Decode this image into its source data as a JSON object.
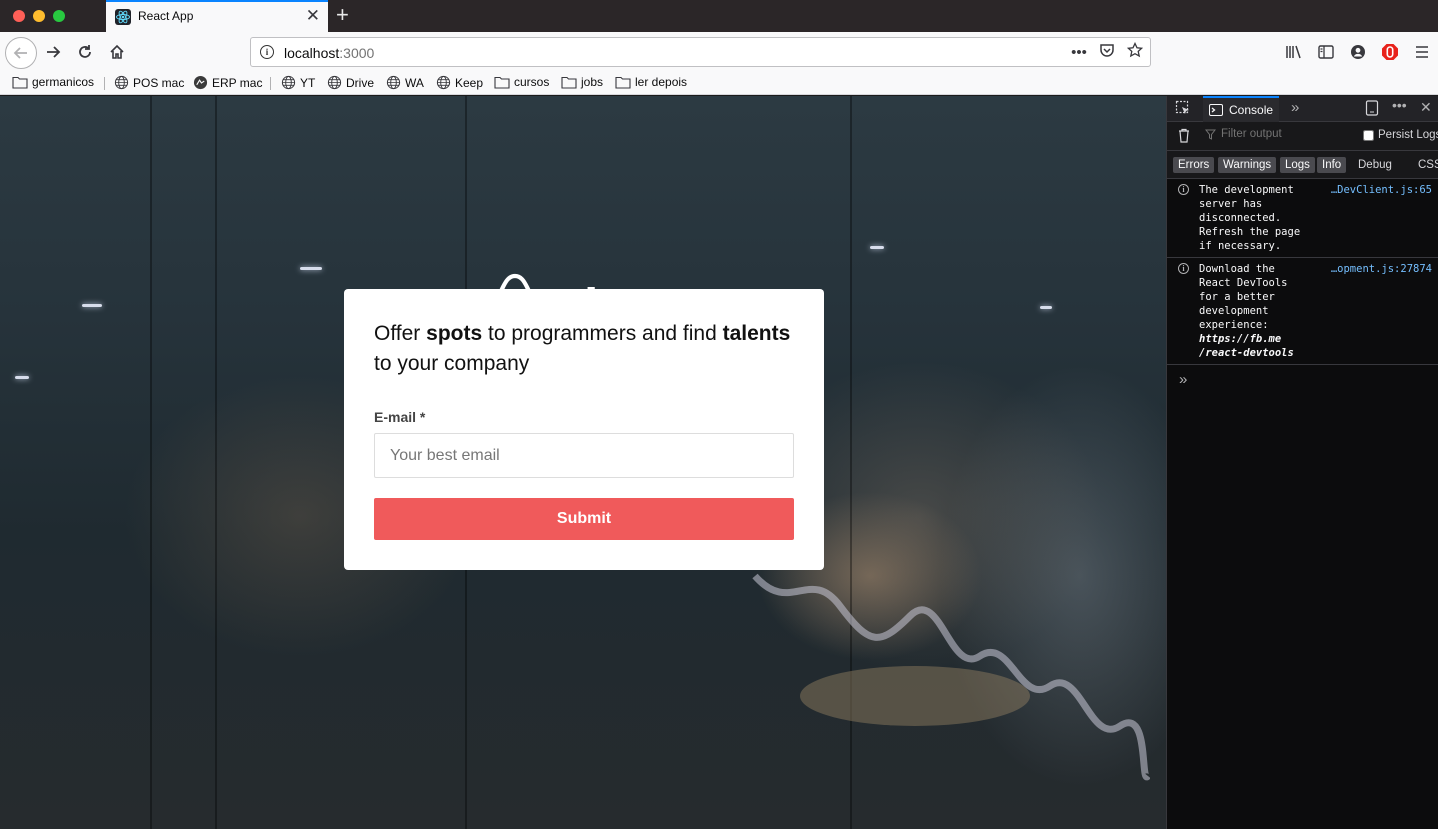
{
  "browser": {
    "tab_title": "React App",
    "tab_close": "✕",
    "new_tab": "+",
    "url_host": "localhost",
    "url_port": ":3000",
    "url_more": "•••",
    "accent": "#0a84ff"
  },
  "bookmarks": [
    {
      "label": "germanicos",
      "icon": "folder-icon"
    },
    {
      "label": "POS mac",
      "icon": "globe-icon"
    },
    {
      "label": "ERP mac",
      "icon": "site-icon"
    },
    {
      "label": "YT",
      "icon": "globe-icon"
    },
    {
      "label": "Drive",
      "icon": "globe-icon"
    },
    {
      "label": "WA",
      "icon": "globe-icon"
    },
    {
      "label": "Keep",
      "icon": "globe-icon"
    },
    {
      "label": "cursos",
      "icon": "folder-icon"
    },
    {
      "label": "jobs",
      "icon": "folder-icon"
    },
    {
      "label": "ler depois",
      "icon": "folder-icon"
    }
  ],
  "page": {
    "logo_text": "aircnc",
    "headline_part1": "Offer ",
    "headline_bold1": "spots",
    "headline_part2": " to programmers and find ",
    "headline_bold2": "talents",
    "headline_part3": " to your company",
    "email_label": "E-mail *",
    "email_placeholder": "Your best email",
    "email_value": "",
    "submit_label": "Submit",
    "submit_color": "#f05a5b"
  },
  "devtools": {
    "console_tab": "Console",
    "filter_placeholder": "Filter output",
    "persist_logs": "Persist Logs",
    "levels": [
      {
        "label": "Errors",
        "active": true
      },
      {
        "label": "Warnings",
        "active": true
      },
      {
        "label": "Logs",
        "active": true
      },
      {
        "label": "Info",
        "active": true
      },
      {
        "label": "Debug",
        "active": false
      },
      {
        "label": "CSS",
        "active": false
      }
    ],
    "messages": [
      {
        "source": "…DevClient.js:65",
        "text": "The development\nserver has\ndisconnected.\nRefresh the page\nif necessary."
      },
      {
        "source": "…opment.js:27874",
        "text": "Download the\nReact DevTools\nfor a better\ndevelopment\nexperience:",
        "link1": "https://fb.me",
        "link2": "/react-devtools"
      }
    ],
    "prompt": "»"
  }
}
